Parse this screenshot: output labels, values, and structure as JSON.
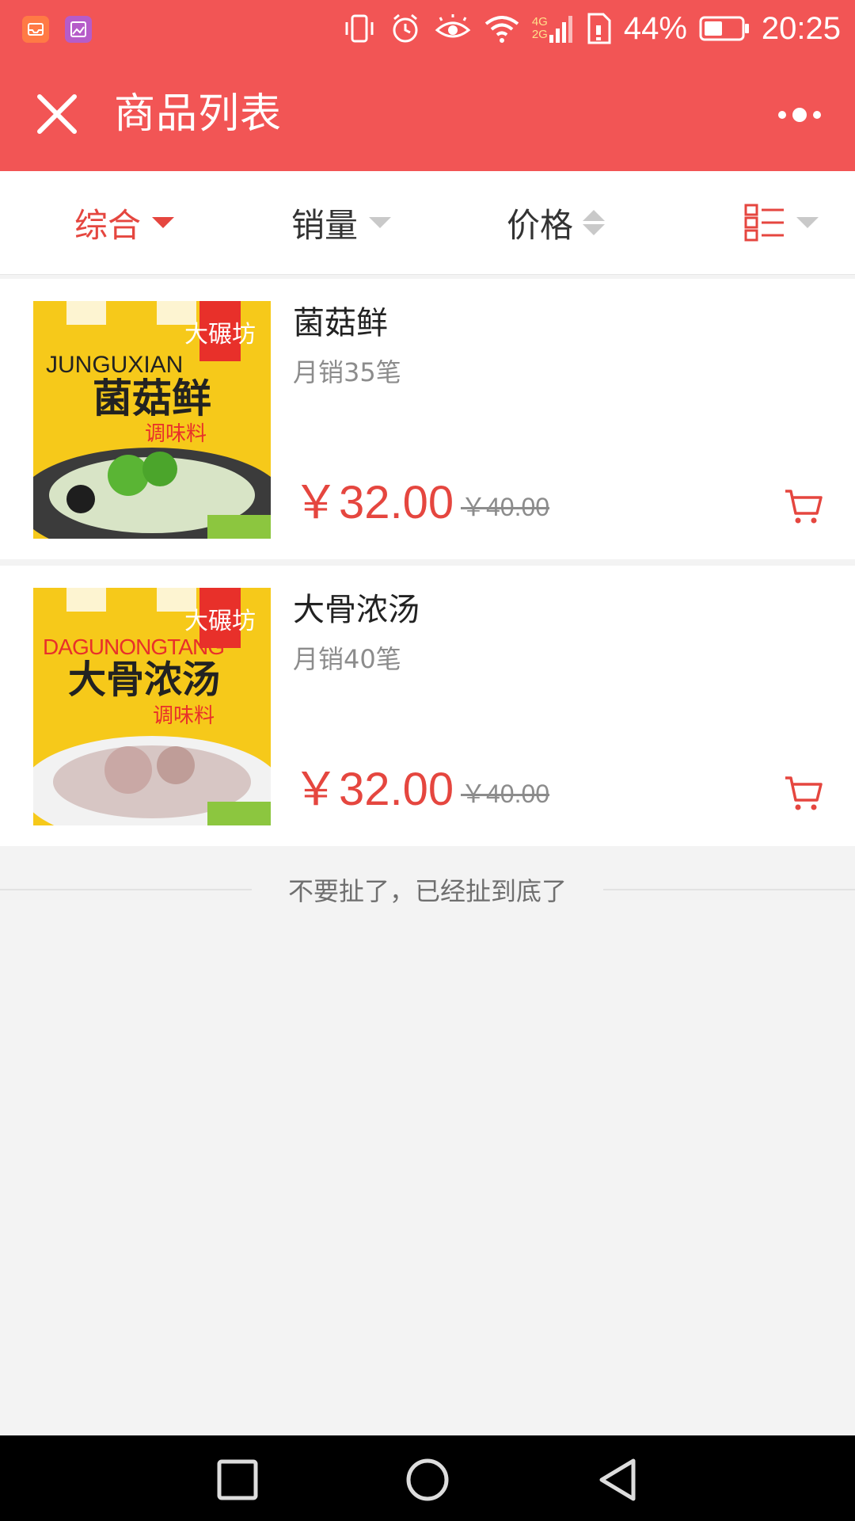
{
  "status_bar": {
    "net_4g": "4G",
    "net_2g": "2G",
    "battery": "44%",
    "time": "20:25"
  },
  "header": {
    "title": "商品列表"
  },
  "filters": {
    "comprehensive": "综合",
    "sales": "销量",
    "price": "价格"
  },
  "products": [
    {
      "name": "菌菇鲜",
      "sales": "月销35笔",
      "price": "￥32.00",
      "original_price": "￥40.00",
      "image_text_en": "JUNGUXIAN",
      "image_text_cn": "菌菇鲜",
      "image_sub": "调味料",
      "image_brand": "大碾坊"
    },
    {
      "name": "大骨浓汤",
      "sales": "月销40笔",
      "price": "￥32.00",
      "original_price": "￥40.00",
      "image_text_en": "DAGUNONGTANG",
      "image_text_cn": "大骨浓汤",
      "image_sub": "调味料",
      "image_brand": "大碾坊"
    }
  ],
  "list_end": "不要扯了，已经扯到底了",
  "colors": {
    "accent": "#f25555",
    "price": "#e5463f"
  }
}
